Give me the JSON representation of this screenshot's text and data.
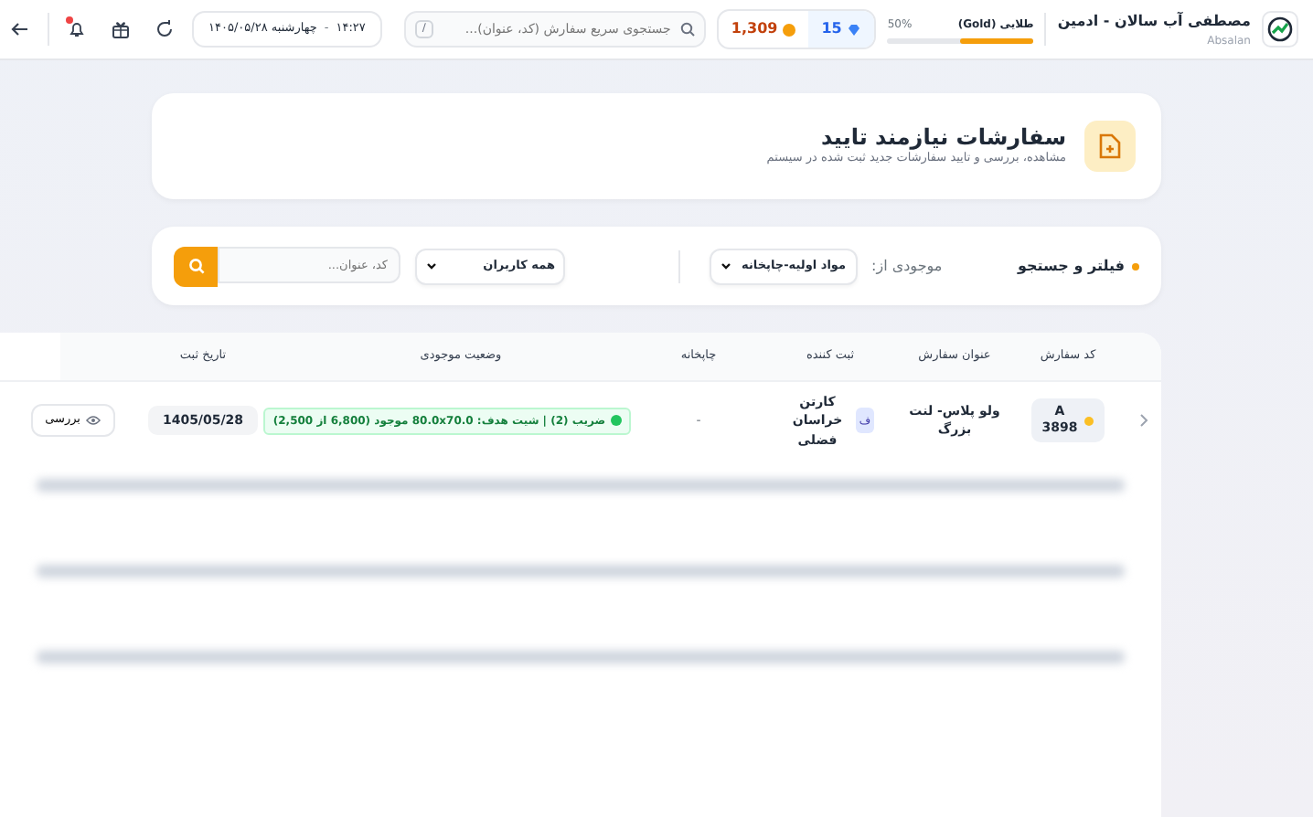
{
  "header": {
    "user": {
      "name": "مصطفی آب سالان - ادمین",
      "username": "Absalan"
    },
    "level": {
      "label": "طلایی (Gold)",
      "percent": "50%",
      "level": 0.5
    },
    "wallet": {
      "diamonds": "15",
      "coins": "1,309"
    },
    "search": {
      "placeholder": "جستجوی سریع سفارش (کد، عنوان)...",
      "shortcut": "/"
    },
    "datetime": {
      "time": "۱۴:۲۷",
      "separator": "-",
      "date": "چهارشنبه ۱۴۰۵/۰۵/۲۸"
    },
    "notifications": {
      "unread": true
    }
  },
  "page": {
    "title": "سفارشات نیازمند تایید",
    "subtitle": "مشاهده، بررسی و تایید سفارشات جدید ثبت شده در سیستم"
  },
  "filter": {
    "title": "فیلتر و جستجو",
    "stock_label": "موجودی از:",
    "stock_value": "مواد اولیه-چاپخانه",
    "users_value": "همه کاربران",
    "search_placeholder": "کد، عنوان..."
  },
  "table": {
    "columns": [
      "کد سفارش",
      "عنوان سفارش",
      "ثبت کننده",
      "چاپخانه",
      "وضعیت موجودی",
      "تاریخ ثبت"
    ],
    "rows": [
      {
        "code_prefix": "A",
        "code": "3898",
        "title": "ولو پلاس- لنت بزرگ",
        "registrant_initial": "ف",
        "registrant": "کارتن خراسان فضلی",
        "printer": "-",
        "stock": "ضریب (2) | شیت هدف: 80.0x70.0 موجود (6,800 از 2,500)",
        "date": "1405/05/28",
        "action": "بررسی"
      }
    ]
  }
}
